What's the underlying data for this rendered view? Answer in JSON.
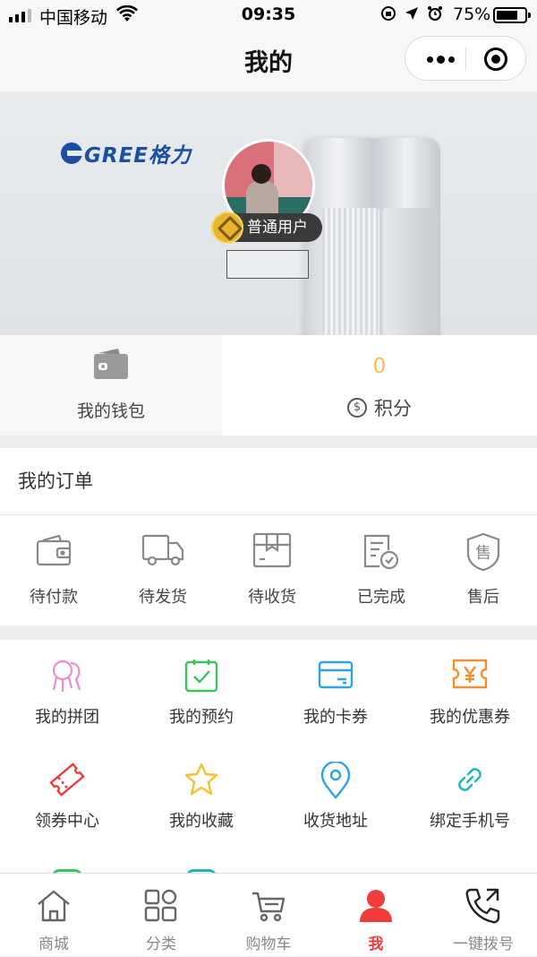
{
  "status_bar": {
    "carrier": "中国移动",
    "time": "09:35",
    "battery_percent_label": "75%",
    "battery_level": 0.75
  },
  "navbar": {
    "title": "我的"
  },
  "banner": {
    "brand_logo_text": "GREE格力",
    "user_level": "普通用户",
    "nickname": ""
  },
  "stats": {
    "wallet_label": "我的钱包",
    "points_value": "0",
    "points_label": "积分",
    "points_icon_glyph": "$"
  },
  "orders": {
    "title": "我的订单",
    "items": [
      {
        "label": "待付款",
        "icon": "wallet-icon"
      },
      {
        "label": "待发货",
        "icon": "truck-icon"
      },
      {
        "label": "待收货",
        "icon": "package-icon"
      },
      {
        "label": "已完成",
        "icon": "document-check-icon"
      },
      {
        "label": "售后",
        "icon": "after-sales-shield-icon"
      }
    ]
  },
  "services": {
    "items": [
      {
        "label": "我的拼团",
        "icon": "group-buy-icon",
        "color": "#f08bd0"
      },
      {
        "label": "我的预约",
        "icon": "calendar-check-icon",
        "color": "#3cc45a"
      },
      {
        "label": "我的卡券",
        "icon": "card-icon",
        "color": "#2ea3e6"
      },
      {
        "label": "我的优惠券",
        "icon": "yen-ticket-icon",
        "color": "#f0902e"
      },
      {
        "label": "领券中心",
        "icon": "ticket-icon",
        "color": "#ee3b3b"
      },
      {
        "label": "我的收藏",
        "icon": "star-icon",
        "color": "#f5c12e"
      },
      {
        "label": "收货地址",
        "icon": "location-pin-icon",
        "color": "#2ea3e6"
      },
      {
        "label": "绑定手机号",
        "icon": "link-icon",
        "color": "#1fb8b8"
      }
    ]
  },
  "tabbar": {
    "items": [
      {
        "label": "商城",
        "icon": "home-icon",
        "active": false
      },
      {
        "label": "分类",
        "icon": "category-grid-icon",
        "active": false
      },
      {
        "label": "购物车",
        "icon": "cart-icon",
        "active": false
      },
      {
        "label": "我",
        "icon": "person-icon",
        "active": true
      },
      {
        "label": "一键拨号",
        "icon": "phone-call-icon",
        "active": false
      }
    ]
  },
  "colors": {
    "accent": "#f23b3b",
    "points": "#f0c14a",
    "brand_blue": "#1c4ea1",
    "badge_bg": "#3a3a3c"
  }
}
